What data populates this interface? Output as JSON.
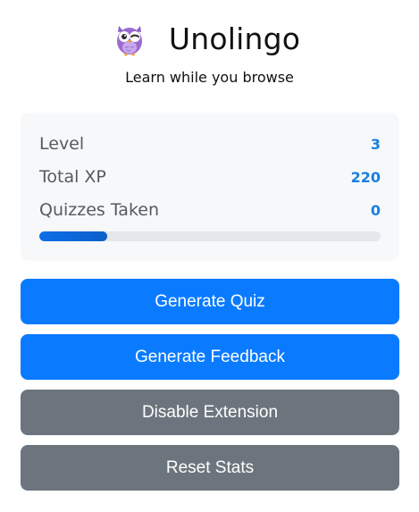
{
  "app": {
    "title": "Unolingo",
    "tagline": "Learn while you browse",
    "logo_icon": "owl-icon"
  },
  "stats": {
    "level_label": "Level",
    "level_value": "3",
    "xp_label": "Total XP",
    "xp_value": "220",
    "quizzes_label": "Quizzes Taken",
    "quizzes_value": "0",
    "progress_fraction": 0.2
  },
  "actions": {
    "generate_quiz": "Generate Quiz",
    "generate_feedback": "Generate Feedback",
    "disable_extension": "Disable Extension",
    "reset_stats": "Reset Stats"
  },
  "colors": {
    "primary": "#0a7bff",
    "secondary": "#6c757d",
    "stat_value": "#1a7fe0",
    "progress_fill": "#0d6ee8",
    "card_bg": "#f7f8fa"
  }
}
